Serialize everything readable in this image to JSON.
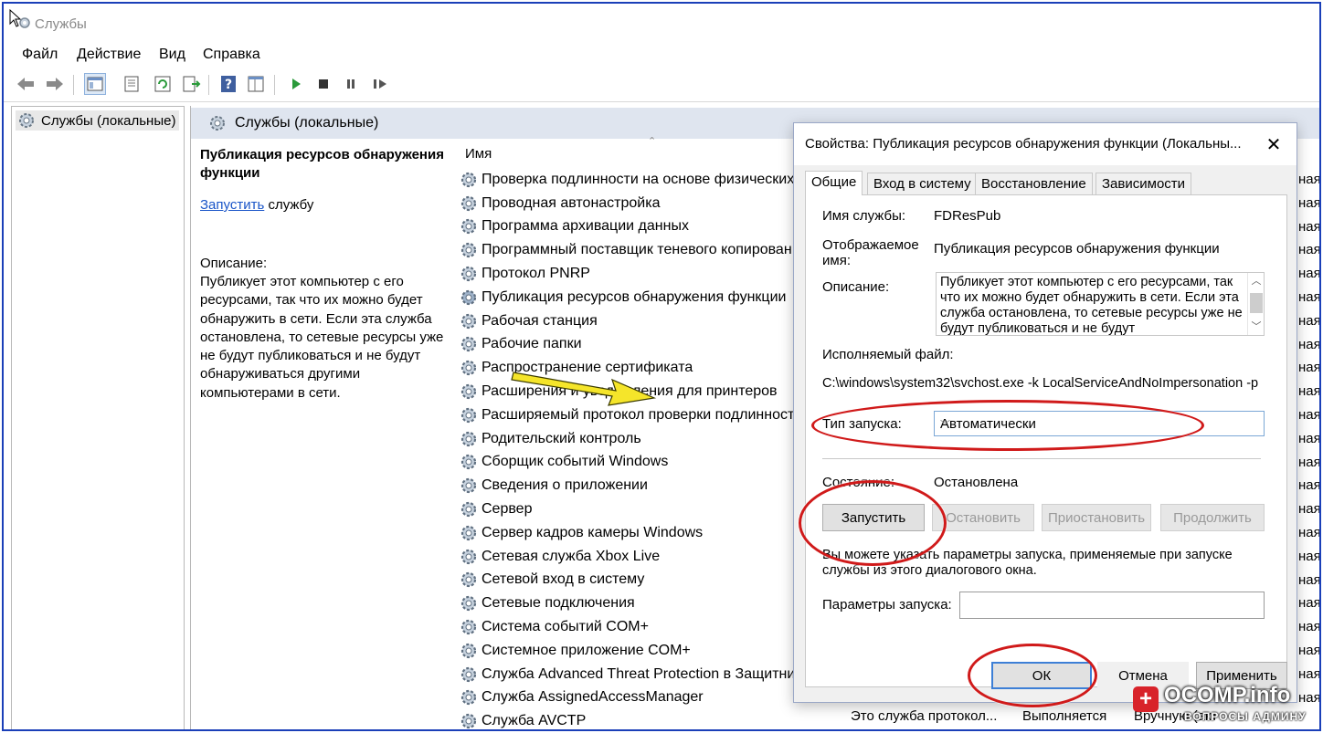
{
  "app": {
    "title": "Службы"
  },
  "menu": [
    "Файл",
    "Действие",
    "Вид",
    "Справка"
  ],
  "tree": {
    "root_label": "Службы (локальные)"
  },
  "main": {
    "header_title": "Службы (локальные)",
    "selected_service_title": "Публикация ресурсов обнаружения функции",
    "start_link": "Запустить",
    "start_link_suffix": " службу",
    "description_label": "Описание:",
    "description_text": "Публикует этот компьютер с его ресурсами, так что их можно будет обнаружить в сети.  Если эта служба остановлена, то сетевые ресурсы уже не будут публиковаться и не будут обнаруживаться другими компьютерами в сети.",
    "column_name": "Имя",
    "services": [
      "Проверка подлинности на основе физических",
      "Проводная автонастройка",
      "Программа архивации данных",
      "Программный поставщик теневого копирован",
      "Протокол PNRP",
      "Публикация ресурсов обнаружения функции",
      "Рабочая станция",
      "Рабочие папки",
      "Распространение сертификата",
      "Расширения и уведомления для принтеров",
      "Расширяемый протокол проверки подлинност",
      "Родительский контроль",
      "Сборщик событий Windows",
      "Сведения о приложении",
      "Сервер",
      "Сервер кадров камеры Windows",
      "Сетевая служба Xbox Live",
      "Сетевой вход в систему",
      "Сетевые подключения",
      "Система событий COM+",
      "Системное приложение COM+",
      "Служба Advanced Threat Protection в Защитник",
      "Служба AssignedAccessManager",
      "Служба AVCTP"
    ],
    "right_column_fragments": [
      "ная",
      "ная",
      "ная",
      "ная",
      "ная",
      "ная",
      "ная",
      "ная",
      "ная",
      "ная",
      "ная",
      "ная",
      "ная",
      "ная",
      "ная",
      "ная",
      "ная",
      "ная",
      "ная",
      "ная",
      "ная",
      "ная",
      "ная"
    ],
    "bottom_desc": "Это служба протокол...",
    "bottom_state": "Выполняется",
    "bottom_startup": "Вручную (акт"
  },
  "dialog": {
    "title": "Свойства: Публикация ресурсов обнаружения функции (Локальны...",
    "tabs": [
      "Общие",
      "Вход в систему",
      "Восстановление",
      "Зависимости"
    ],
    "service_name_label": "Имя службы:",
    "service_name": "FDResPub",
    "display_name_label": "Отображаемое\nимя:",
    "display_name": "Публикация ресурсов обнаружения функции",
    "description_label": "Описание:",
    "description": "Публикует этот компьютер с его ресурсами, так что их можно будет обнаружить в сети.  Если эта служба остановлена, то сетевые ресурсы уже не будут публиковаться и не будут",
    "exe_label": "Исполняемый файл:",
    "exe_path": "C:\\windows\\system32\\svchost.exe -k LocalServiceAndNoImpersonation -p",
    "startup_type_label": "Тип запуска:",
    "startup_type": "Автоматически",
    "state_label": "Состояние:",
    "state_value": "Остановлена",
    "btn_start": "Запустить",
    "btn_stop": "Остановить",
    "btn_pause": "Приостановить",
    "btn_resume": "Продолжить",
    "hint": "Вы можете указать параметры запуска, применяемые при запуске службы из этого диалогового окна.",
    "params_label": "Параметры запуска:",
    "params_value": "",
    "btn_ok": "ОК",
    "btn_cancel": "Отмена",
    "btn_apply": "Применить"
  },
  "watermark": {
    "text": "OCOMP.info",
    "badge": "+",
    "sub": "ВОПРОСЫ АДМИНУ"
  },
  "colors": {
    "frame": "#1a3fb8",
    "annotation_red": "#d01a1a",
    "arrow_yellow": "#f5e52a",
    "link": "#1a55c8",
    "header_band": "#dfe5ef"
  }
}
